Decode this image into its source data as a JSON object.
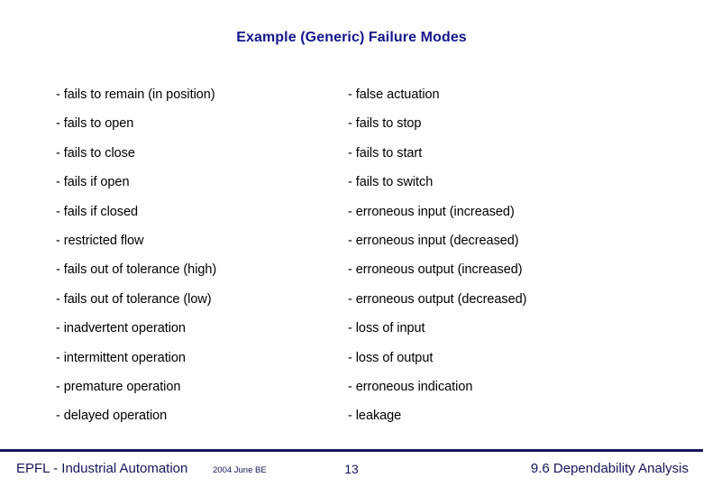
{
  "slide": {
    "title": "Example (Generic) Failure Modes",
    "title_color": "#15158c",
    "background_color": "#ffffff",
    "body_text_color": "#000000"
  },
  "columns": {
    "left": [
      "- fails to remain (in position)",
      "- fails to open",
      "- fails to close",
      "- fails if open",
      "- fails if closed",
      "- restricted flow",
      "- fails out of tolerance (high)",
      "- fails out of tolerance (low)",
      "- inadvertent operation",
      "- intermittent operation",
      "- premature operation",
      "- delayed operation"
    ],
    "right": [
      "- false actuation",
      "- fails to stop",
      "- fails to start",
      "- fails to switch",
      "- erroneous input (increased)",
      "- erroneous input (decreased)",
      "- erroneous output (increased)",
      "- erroneous output (decreased)",
      "- loss of input",
      "- loss of output",
      "- erroneous indication",
      "- leakage"
    ]
  },
  "footer": {
    "organization": "EPFL - Industrial Automation",
    "date": "2004 June BE",
    "page_number": "13",
    "section": "9.6 Dependability Analysis",
    "rule_color": "#15155c",
    "text_color": "#15155c"
  }
}
